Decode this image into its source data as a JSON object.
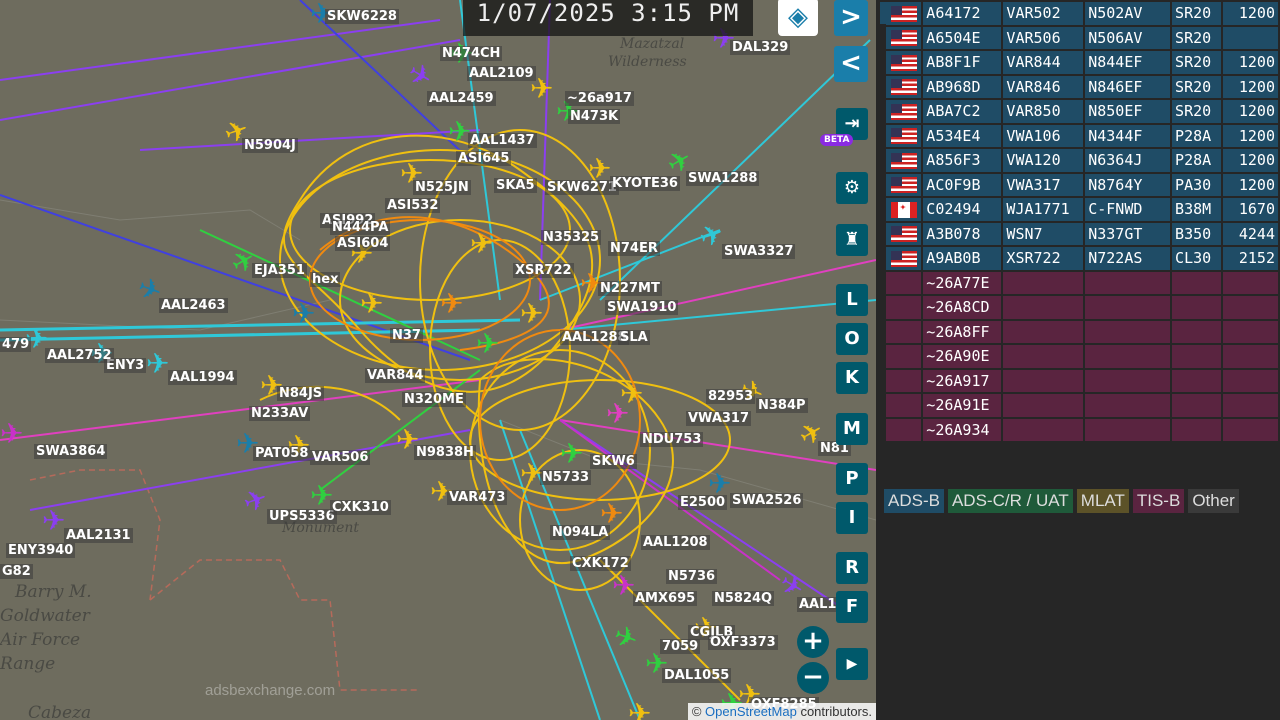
{
  "map": {
    "timestamp": "1/07/2025 3:15 PM",
    "attribution": {
      "prefix": "©",
      "link": "OpenStreetMap",
      "suffix": "contributors."
    },
    "watermark": "adsbexchange.com",
    "beta_badge": "BETA",
    "places": [
      "Barry M.",
      "Goldwater",
      "Air Force",
      "Range",
      "Cabeza",
      "Mazatzal",
      "Wilderness",
      "Monument"
    ],
    "flight_labels": [
      "SKW6228",
      "DAL329",
      "N474CH",
      "AAL2109",
      "AAL2459",
      "~26a917",
      "N473K",
      "N5904J",
      "AAL1437",
      "ASI645",
      "SKA5",
      "SKW6271",
      "KYOTE36",
      "SWA1288",
      "N525JN",
      "ASI532",
      "ASI992",
      "N444PA",
      "ASI604",
      "EJA351",
      "N35325",
      "N74ER",
      "SWA3327",
      "XSR722",
      "N227MT",
      "AAL2463",
      "hex",
      "SWA1910",
      "N37",
      "AAL1288",
      "SLA",
      "ENY3",
      "AAL2752",
      "479",
      "AAL1994",
      "N84JS",
      "VAR844",
      "N233AV",
      "N320ME",
      "N384P",
      "VWA317",
      "82953",
      "SWA3864",
      "PAT058",
      "VAR506",
      "N9838H",
      "N81",
      "N5733",
      "VAR473",
      "SWA2526",
      "UPS5336",
      "CXK310",
      "E2500",
      "AAL2131",
      "AAL1208",
      "ENY3940",
      "G82",
      "CXK172",
      "N5824Q",
      "AAL1",
      "AMX695",
      "N5736",
      "CGJLB",
      "OXF3373",
      "7059",
      "DAL1055",
      "OXF8285",
      "NDU753",
      "N094LA",
      "SKW6"
    ],
    "controls": {
      "next": ">",
      "prev": "<",
      "login": "⇥",
      "settings": "⚙",
      "filter": "♜",
      "letters": [
        "L",
        "O",
        "K",
        "M",
        "P",
        "I",
        "R",
        "F"
      ],
      "zoom_in": "+",
      "zoom_out": "−",
      "play": "▶"
    }
  },
  "aircraft_table": {
    "rows": [
      {
        "hex": "A64172",
        "callsign": "VAR502",
        "reg": "N502AV",
        "type": "SR20",
        "alt": "1200",
        "flag": "us",
        "source": "adsb"
      },
      {
        "hex": "A6504E",
        "callsign": "VAR506",
        "reg": "N506AV",
        "type": "SR20",
        "alt": "",
        "flag": "us",
        "source": "adsb"
      },
      {
        "hex": "AB8F1F",
        "callsign": "VAR844",
        "reg": "N844EF",
        "type": "SR20",
        "alt": "1200",
        "flag": "us",
        "source": "adsb"
      },
      {
        "hex": "AB968D",
        "callsign": "VAR846",
        "reg": "N846EF",
        "type": "SR20",
        "alt": "1200",
        "flag": "us",
        "source": "adsb"
      },
      {
        "hex": "ABA7C2",
        "callsign": "VAR850",
        "reg": "N850EF",
        "type": "SR20",
        "alt": "1200",
        "flag": "us",
        "source": "adsb"
      },
      {
        "hex": "A534E4",
        "callsign": "VWA106",
        "reg": "N4344F",
        "type": "P28A",
        "alt": "1200",
        "flag": "us",
        "source": "adsb"
      },
      {
        "hex": "A856F3",
        "callsign": "VWA120",
        "reg": "N6364J",
        "type": "P28A",
        "alt": "1200",
        "flag": "us",
        "source": "adsb"
      },
      {
        "hex": "AC0F9B",
        "callsign": "VWA317",
        "reg": "N8764Y",
        "type": "PA30",
        "alt": "1200",
        "flag": "us",
        "source": "adsb"
      },
      {
        "hex": "C02494",
        "callsign": "WJA1771",
        "reg": "C-FNWD",
        "type": "B38M",
        "alt": "1670",
        "flag": "ca",
        "source": "adsb"
      },
      {
        "hex": "A3B078",
        "callsign": "WSN7",
        "reg": "N337GT",
        "type": "B350",
        "alt": "4244",
        "flag": "us",
        "source": "adsb"
      },
      {
        "hex": "A9AB0B",
        "callsign": "XSR722",
        "reg": "N722AS",
        "type": "CL30",
        "alt": "2152",
        "flag": "us",
        "source": "adsb"
      },
      {
        "hex": "~26A77E",
        "callsign": "",
        "reg": "",
        "type": "",
        "alt": "",
        "flag": "",
        "source": "tisb"
      },
      {
        "hex": "~26A8CD",
        "callsign": "",
        "reg": "",
        "type": "",
        "alt": "",
        "flag": "",
        "source": "tisb"
      },
      {
        "hex": "~26A8FF",
        "callsign": "",
        "reg": "",
        "type": "",
        "alt": "",
        "flag": "",
        "source": "tisb"
      },
      {
        "hex": "~26A90E",
        "callsign": "",
        "reg": "",
        "type": "",
        "alt": "",
        "flag": "",
        "source": "tisb"
      },
      {
        "hex": "~26A917",
        "callsign": "",
        "reg": "",
        "type": "",
        "alt": "",
        "flag": "",
        "source": "tisb"
      },
      {
        "hex": "~26A91E",
        "callsign": "",
        "reg": "",
        "type": "",
        "alt": "",
        "flag": "",
        "source": "tisb"
      },
      {
        "hex": "~26A934",
        "callsign": "",
        "reg": "",
        "type": "",
        "alt": "",
        "flag": "",
        "source": "tisb"
      }
    ]
  },
  "legend": [
    {
      "label": "ADS-B",
      "color": "#1f4c66"
    },
    {
      "label": "ADS-C/R / UAT",
      "color": "#1f5a3a"
    },
    {
      "label": "MLAT",
      "color": "#5c5228"
    },
    {
      "label": "TIS-B",
      "color": "#5a2440"
    },
    {
      "label": "Other",
      "color": "#3a3a3a"
    }
  ]
}
